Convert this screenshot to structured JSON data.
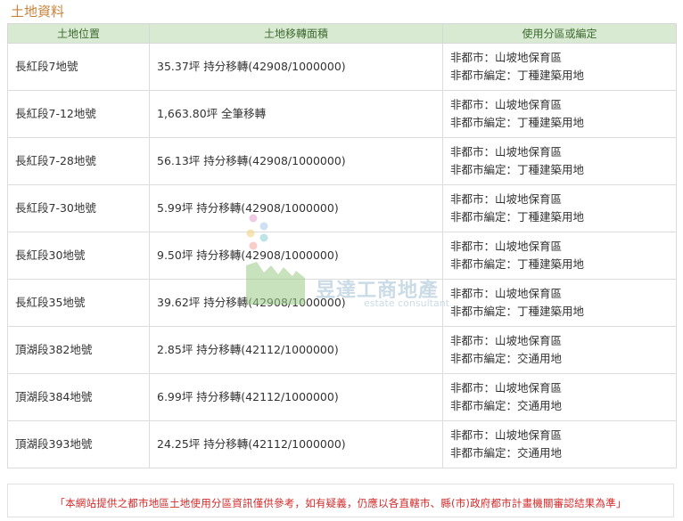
{
  "section_title": "土地資料",
  "table": {
    "headers": [
      "土地位置",
      "土地移轉面積",
      "使用分區或編定"
    ],
    "rows": [
      {
        "location": "長紅段7地號",
        "area": "35.37坪 持分移轉(42908/1000000)",
        "zoning": [
          "非都市：山坡地保育區",
          "非都市編定：丁種建築用地"
        ]
      },
      {
        "location": "長紅段7-12地號",
        "area": "1,663.80坪 全筆移轉",
        "zoning": [
          "非都市：山坡地保育區",
          "非都市編定：丁種建築用地"
        ]
      },
      {
        "location": "長紅段7-28地號",
        "area": "56.13坪 持分移轉(42908/1000000)",
        "zoning": [
          "非都市：山坡地保育區",
          "非都市編定：丁種建築用地"
        ]
      },
      {
        "location": "長紅段7-30地號",
        "area": "5.99坪 持分移轉(42908/1000000)",
        "zoning": [
          "非都市：山坡地保育區",
          "非都市編定：丁種建築用地"
        ]
      },
      {
        "location": "長紅段30地號",
        "area": "9.50坪 持分移轉(42908/1000000)",
        "zoning": [
          "非都市：山坡地保育區",
          "非都市編定：丁種建築用地"
        ]
      },
      {
        "location": "長紅段35地號",
        "area": "39.62坪 持分移轉(42908/1000000)",
        "zoning": [
          "非都市：山坡地保育區",
          "非都市編定：丁種建築用地"
        ]
      },
      {
        "location": "頂湖段382地號",
        "area": "2.85坪 持分移轉(42112/1000000)",
        "zoning": [
          "非都市：山坡地保育區",
          "非都市編定：交通用地"
        ]
      },
      {
        "location": "頂湖段384地號",
        "area": "6.99坪 持分移轉(42112/1000000)",
        "zoning": [
          "非都市：山坡地保育區",
          "非都市編定：交通用地"
        ]
      },
      {
        "location": "頂湖段393地號",
        "area": "24.25坪 持分移轉(42112/1000000)",
        "zoning": [
          "非都市：山坡地保育區",
          "非都市編定：交通用地"
        ]
      }
    ]
  },
  "watermark": {
    "name": "昱達工商地產",
    "tagline": "estate consultant"
  },
  "disclaimer": "「本網站提供之都市地區土地使用分區資訊僅供參考，如有疑義，仍應以各直轄市、縣(市)政府都市計畫機關審認結果為準」",
  "colors": {
    "title": "#c8843c",
    "header_bg": "#d9ead3",
    "header_text": "#3d6b2f",
    "disclaimer": "#d22a2a"
  }
}
